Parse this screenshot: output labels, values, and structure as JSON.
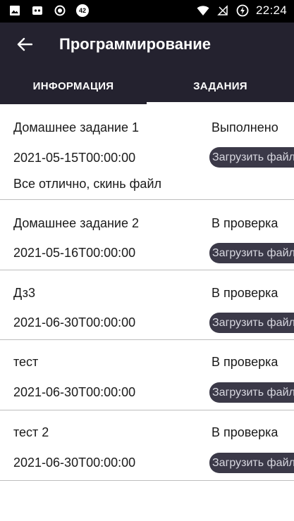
{
  "status_bar": {
    "time": "22:24",
    "notification_badge": "42",
    "icons": [
      "image-icon",
      "shield-icon",
      "record-icon",
      "badge-icon",
      "wifi-icon",
      "no-signal-icon",
      "battery-charging-icon"
    ]
  },
  "app_bar": {
    "back_icon": "arrow-left-icon",
    "title": "Программирование"
  },
  "tabs": [
    {
      "label": "ИНФОРМАЦИЯ",
      "selected": false
    },
    {
      "label": "ЗАДАНИЯ",
      "selected": true
    }
  ],
  "tasks": [
    {
      "name": "Домашнее задание 1",
      "status": "Выполнено",
      "date": "2021-05-15T00:00:00",
      "button": "Загрузить файл",
      "comment": "Все отлично, скинь файл"
    },
    {
      "name": "Домашнее задание 2",
      "status": "В проверка",
      "date": "2021-05-16T00:00:00",
      "button": "Загрузить файл"
    },
    {
      "name": "Дз3",
      "status": "В проверка",
      "date": "2021-06-30T00:00:00",
      "button": "Загрузить файл"
    },
    {
      "name": "тест",
      "status": "В проверка",
      "date": "2021-06-30T00:00:00",
      "button": "Загрузить файл"
    },
    {
      "name": "тест 2",
      "status": "В проверка",
      "date": "2021-06-30T00:00:00",
      "button": "Загрузить файл"
    }
  ],
  "colors": {
    "app_bar": "#24222f",
    "button_bg": "#3b3948",
    "button_text": "#d8d8e0",
    "divider": "#bdbdbd"
  }
}
